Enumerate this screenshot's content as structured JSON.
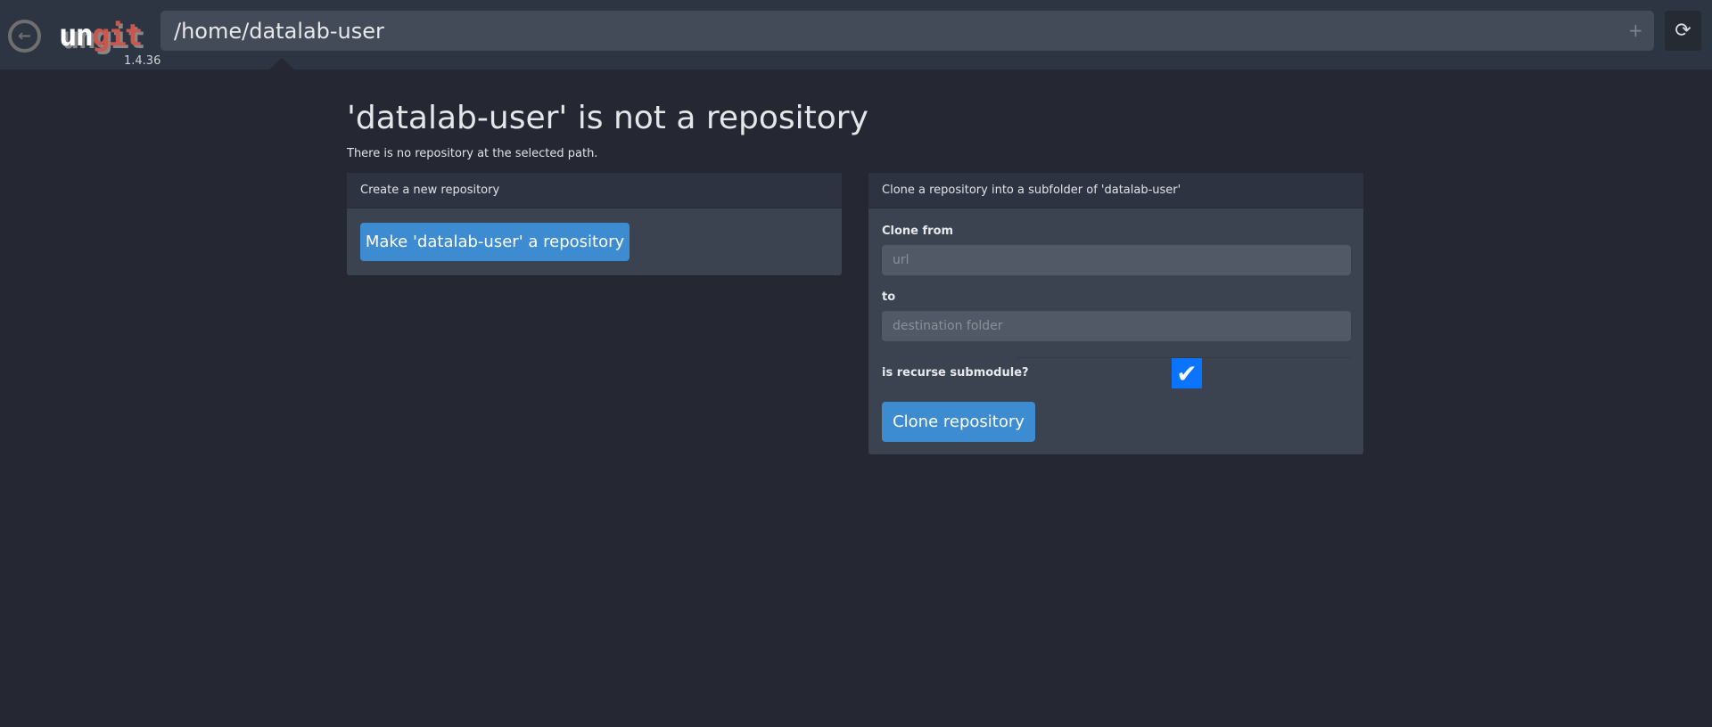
{
  "header": {
    "logo_text": "ungit",
    "version": "1.4.36",
    "path_value": "/home/datalab-user",
    "plus_icon": "+",
    "refresh_icon": "⟳"
  },
  "main": {
    "title": "'datalab-user' is not a repository",
    "subtitle": "There is no repository at the selected path.",
    "create_panel": {
      "heading": "Create a new repository",
      "button": "Make 'datalab-user' a repository"
    },
    "clone_panel": {
      "heading": "Clone a repository into a subfolder of 'datalab-user'",
      "from_label": "Clone from",
      "url_placeholder": "url",
      "to_label": "to",
      "dest_placeholder": "destination folder",
      "recurse_label": "is recurse submodule?",
      "recurse_checked": true,
      "button": "Clone repository"
    }
  },
  "colors": {
    "accent": "#3d8bd0",
    "checkbox": "#0a74ff",
    "logo_red": "#c9574e"
  }
}
